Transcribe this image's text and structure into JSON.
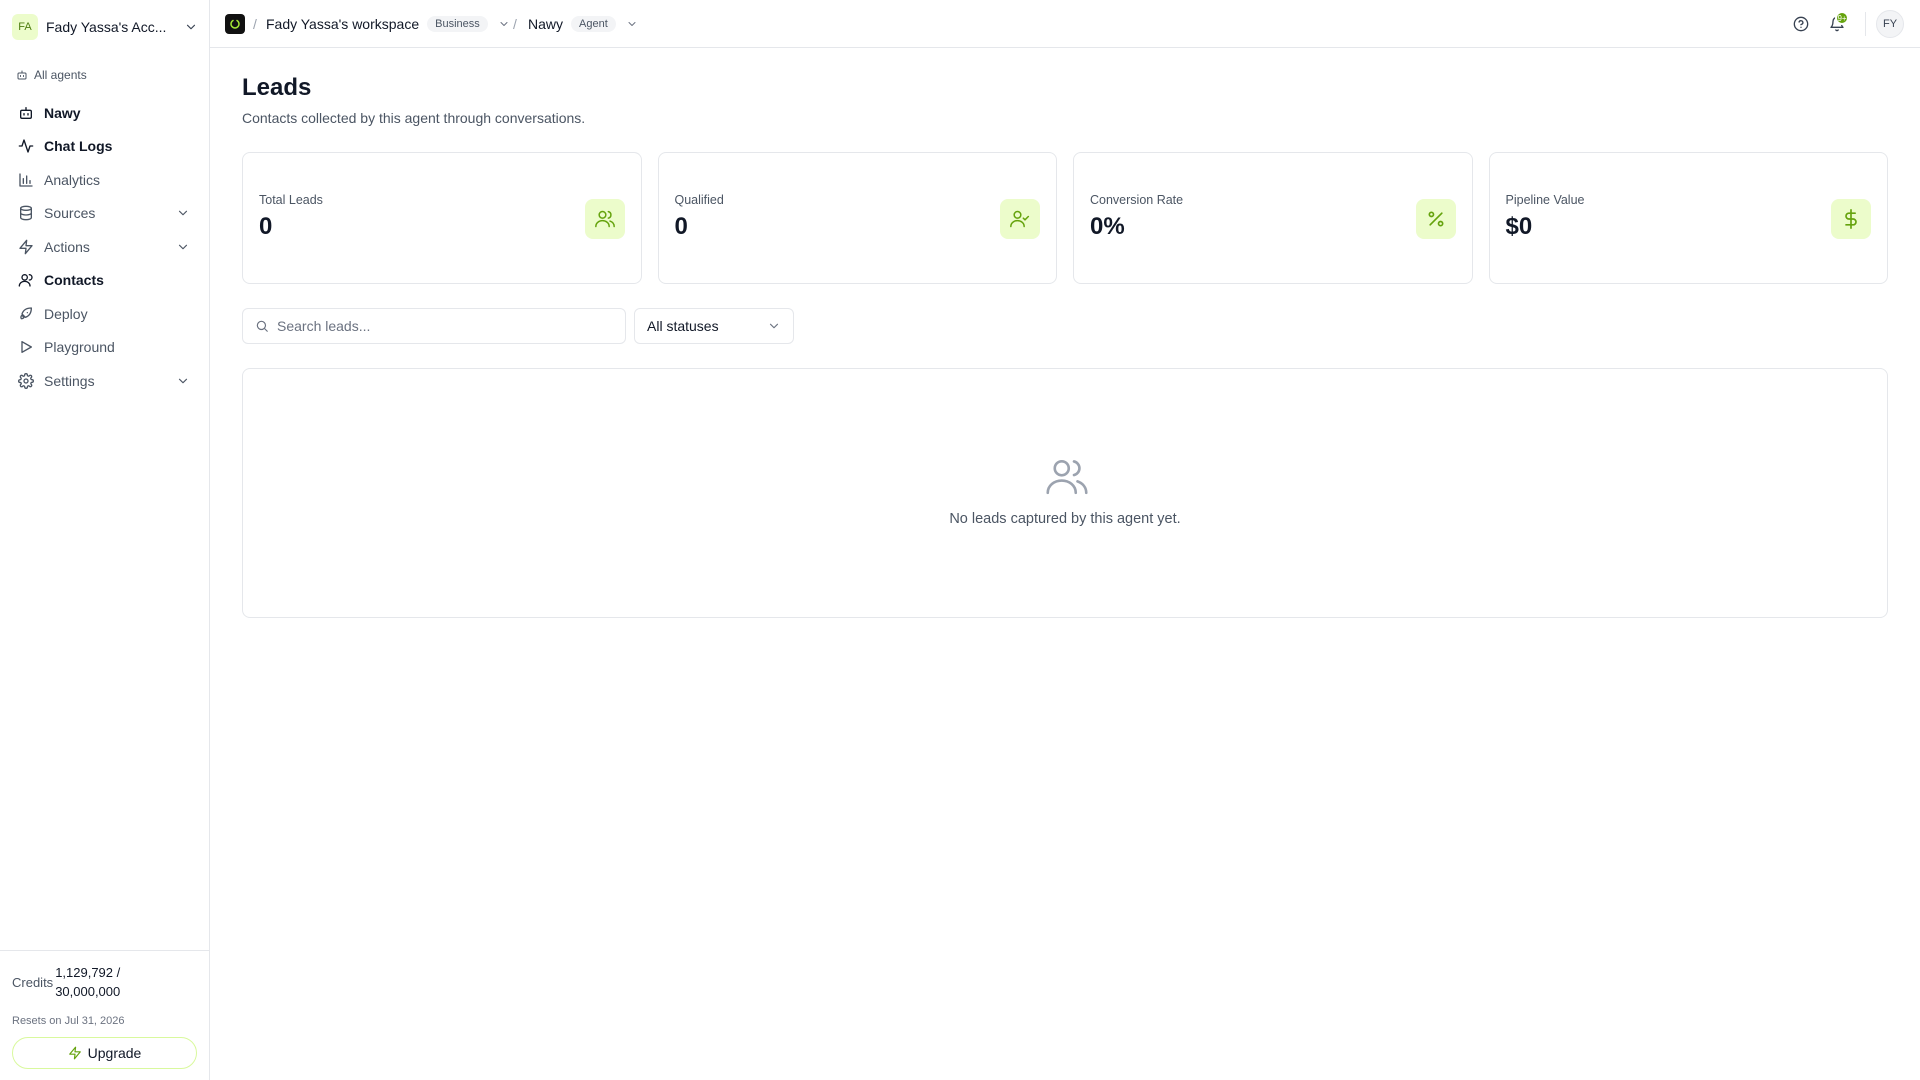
{
  "colors": {
    "accent": "#65a30d",
    "accent_bg": "#ecfccb",
    "border": "#e5e7eb"
  },
  "sidebar": {
    "account_initials": "FA",
    "account_name": "Fady Yassa's Acc...",
    "all_agents_label": "All agents",
    "items": [
      {
        "label": "Nawy",
        "icon": "bot-icon"
      },
      {
        "label": "Chat Logs",
        "icon": "activity-icon"
      },
      {
        "label": "Analytics",
        "icon": "bar-chart-icon"
      },
      {
        "label": "Sources",
        "icon": "database-icon",
        "expandable": true
      },
      {
        "label": "Actions",
        "icon": "zap-icon",
        "expandable": true
      },
      {
        "label": "Contacts",
        "icon": "user-icon",
        "active": true
      },
      {
        "label": "Deploy",
        "icon": "rocket-icon"
      },
      {
        "label": "Playground",
        "icon": "play-icon"
      },
      {
        "label": "Settings",
        "icon": "gear-icon",
        "expandable": true
      }
    ],
    "credits_label": "Credits",
    "credits_value": "1,129,792 / 30,000,000",
    "resets_text": "Resets on Jul 31, 2026",
    "upgrade_label": "Upgrade"
  },
  "topbar": {
    "workspace_name": "Fady Yassa's workspace",
    "workspace_badge": "Business",
    "agent_name": "Nawy",
    "agent_badge": "Agent",
    "separator": "/",
    "notification_count": "9+",
    "user_initials": "FY"
  },
  "main": {
    "title": "Leads",
    "subtitle": "Contacts collected by this agent through conversations.",
    "stats": [
      {
        "label": "Total Leads",
        "value": "0",
        "icon": "users-icon"
      },
      {
        "label": "Qualified",
        "value": "0",
        "icon": "user-check-icon"
      },
      {
        "label": "Conversion Rate",
        "value": "0%",
        "icon": "percent-icon"
      },
      {
        "label": "Pipeline Value",
        "value": "$0",
        "icon": "dollar-icon"
      }
    ],
    "search_placeholder": "Search leads...",
    "status_filter_value": "All statuses",
    "empty_text": "No leads captured by this agent yet."
  }
}
